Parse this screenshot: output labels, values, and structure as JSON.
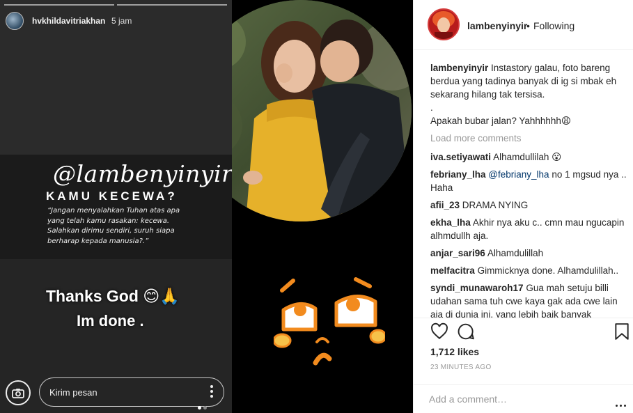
{
  "story": {
    "username": "hvkhildavitriakhan",
    "time": "5 jam",
    "quote_handle": "@lambenyinyir",
    "quote_title": "KAMU KECEWA?",
    "quote_text": "“Jangan menyalahkan Tuhan atas apa yang telah kamu rasakan: kecewa. Salahkan dirimu sendiri, suruh siapa berharap kepada manusia?.”",
    "thanks_text": "Thanks God 😊🙏",
    "done_text": "Im done .",
    "message_placeholder": "Kirim pesan",
    "camera_icon": "camera-icon",
    "dot_colors": [
      "#ffffff",
      "#888888"
    ]
  },
  "post": {
    "username": "lambenyinyir",
    "separator": "•",
    "follow_status": "Following",
    "caption_user": "lambenyinyir",
    "caption_text": "Instastory galau, foto bareng berdua yang tadinya banyak di ig si mbak eh sekarang hilang tak tersisa.",
    "caption_dot": ".",
    "caption_question": "Apakah bubar jalan? Yahhhhhh😩",
    "load_more": "Load more comments",
    "comments": [
      {
        "user": "iva.setiyawati",
        "text": "Alhamdullilah 😮"
      },
      {
        "user": "febriany_lha",
        "mention": "@febriany_lha",
        "text": "no 1 mgsud nya .. Haha"
      },
      {
        "user": "afii_23",
        "text": "DRAMA NYING"
      },
      {
        "user": "ekha_lha",
        "text": "Akhir nya aku c.. cmn mau ngucapin alhmdullh aja."
      },
      {
        "user": "anjar_sari96",
        "text": "Alhamdulillah"
      },
      {
        "user": "melfacitra",
        "text": "Gimmicknya done. Alhamdulillah.."
      },
      {
        "user": "syndi_munawaroh17",
        "text": "Gua mah setuju billi udahan sama tuh cwe kaya gak ada cwe lain aja di dunia ini, yang lebih baik banyak"
      }
    ],
    "likes": "1,712 likes",
    "time_ago": "23 MINUTES AGO",
    "add_comment_placeholder": "Add a comment…",
    "icons": {
      "like": "heart-icon",
      "comment": "speech-bubble-icon",
      "save": "bookmark-icon",
      "more": "more-icon"
    }
  }
}
